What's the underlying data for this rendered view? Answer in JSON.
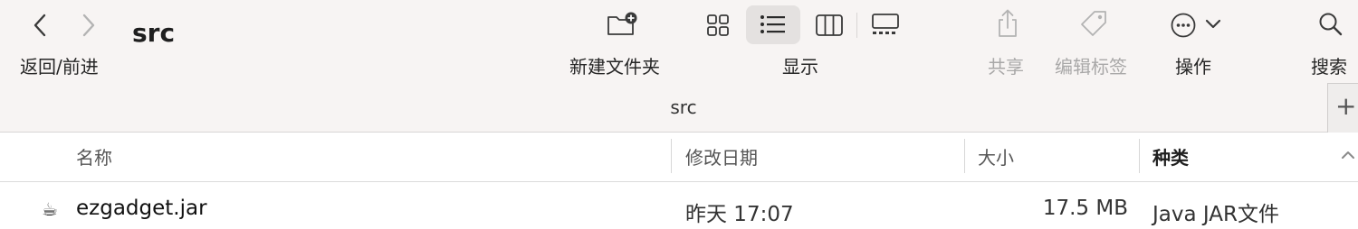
{
  "toolbar": {
    "title": "src",
    "back_forward_label": "返回/前进",
    "new_folder_label": "新建文件夹",
    "view_label": "显示",
    "share_label": "共享",
    "edit_tags_label": "编辑标签",
    "action_label": "操作",
    "search_label": "搜索",
    "selected_view": "list",
    "icons": [
      "chevron-left-icon",
      "chevron-right-icon",
      "new-folder-icon",
      "grid-view-icon",
      "list-view-icon",
      "column-view-icon",
      "gallery-view-icon",
      "share-icon",
      "tag-icon",
      "ellipsis-circle-icon",
      "chevron-down-icon",
      "search-icon"
    ]
  },
  "pathbar": {
    "path": "src",
    "add_tab_symbol": "+"
  },
  "columns": {
    "name": "名称",
    "date_modified": "修改日期",
    "size": "大小",
    "kind": "种类",
    "sorted_by": "种类"
  },
  "files": [
    {
      "icon": "java-jar-icon",
      "glyph": "☕",
      "name": "ezgadget.jar",
      "date_modified": "昨天 17:07",
      "size": "17.5 MB",
      "kind": "Java JAR文件"
    }
  ],
  "colors": {
    "toolbar_bg": "#f7f4f3",
    "selected_segment": "#e4e1e0",
    "disabled_text": "#a9a8a8"
  }
}
